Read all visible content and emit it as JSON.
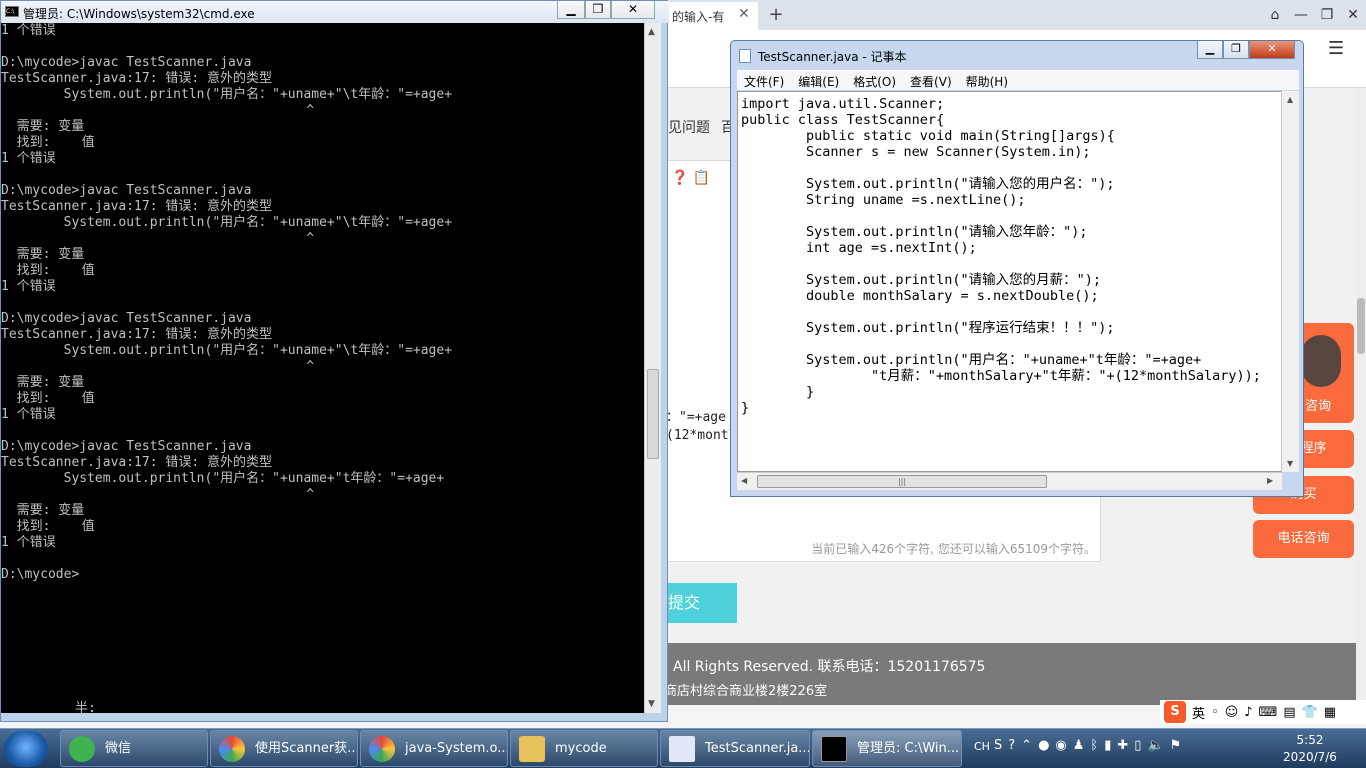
{
  "browser": {
    "tab_title": "的输入-有",
    "tab_close": "✕",
    "new_tab": "+",
    "faq_label": "见问题",
    "faq_label2": "百",
    "code_fragment1": "：\"=+age",
    "code_fragment2": "(12*montl",
    "char_counter": "当前已输入426个字符, 您还可以输入65109个字符。",
    "submit_label": "提交",
    "side_consult": "咨询",
    "side_program": "程序",
    "side_buy": "购买",
    "side_phone": "电话咨询",
    "footer_line1": "All Rights Reserved. 联系电话：15201176575",
    "footer_line2": "商店村综合商业楼2楼226室"
  },
  "ime": {
    "logo": "S",
    "lang": "英"
  },
  "cmd": {
    "title": "管理员: C:\\Windows\\system32\\cmd.exe",
    "icon_label": "C:\\",
    "lines": [
      "1 个错误",
      "",
      "D:\\mycode>javac TestScanner.java",
      "TestScanner.java:17: 错误: 意外的类型",
      "        System.out.println(\"用户名：\"+uname+\"\\t年龄：\"=+age+",
      "                                       ^",
      "  需要: 变量",
      "  找到:    值",
      "1 个错误",
      "",
      "D:\\mycode>javac TestScanner.java",
      "TestScanner.java:17: 错误: 意外的类型",
      "        System.out.println(\"用户名：\"+uname+\"\\t年龄：\"=+age+",
      "                                       ^",
      "  需要: 变量",
      "  找到:    值",
      "1 个错误",
      "",
      "D:\\mycode>javac TestScanner.java",
      "TestScanner.java:17: 错误: 意外的类型",
      "        System.out.println(\"用户名：\"+uname+\"\\t年龄：\"=+age+",
      "                                       ^",
      "  需要: 变量",
      "  找到:    值",
      "1 个错误",
      "",
      "D:\\mycode>javac TestScanner.java",
      "TestScanner.java:17: 错误: 意外的类型",
      "        System.out.println(\"用户名：\"+uname+\"t年龄：\"=+age+",
      "                                       ^",
      "  需要: 变量",
      "  找到:    值",
      "1 个错误",
      "",
      "D:\\mycode>"
    ],
    "ime_text": "半:"
  },
  "notepad": {
    "title": "TestScanner.java - 记事本",
    "menu": [
      "文件(F)",
      "编辑(E)",
      "格式(O)",
      "查看(V)",
      "帮助(H)"
    ],
    "lines": [
      "import java.util.Scanner;",
      "public class TestScanner{",
      "        public static void main(String[]args){",
      "        Scanner s = new Scanner(System.in);",
      "",
      "        System.out.println(\"请输入您的用户名：\");",
      "        String uname =s.nextLine();",
      "",
      "        System.out.println(\"请输入您年龄：\");",
      "        int age =s.nextInt();",
      "",
      "        System.out.println(\"请输入您的月薪：\");",
      "        double monthSalary = s.nextDouble();",
      "",
      "        System.out.println(\"程序运行结束！！！\");",
      "",
      "        System.out.println(\"用户名：\"+uname+\"t年龄：\"=+age+",
      "                \"t月薪：\"+monthSalary+\"t年薪：\"+(12*monthSalary));",
      "        }",
      "}"
    ]
  },
  "taskbar": {
    "items": [
      "微信",
      "使用Scanner获...",
      "java-System.o...",
      "mycode",
      "TestScanner.ja...",
      "管理员: C:\\Win..."
    ],
    "tray_lang": "CH",
    "time": "5:52",
    "date": "2020/7/6"
  }
}
